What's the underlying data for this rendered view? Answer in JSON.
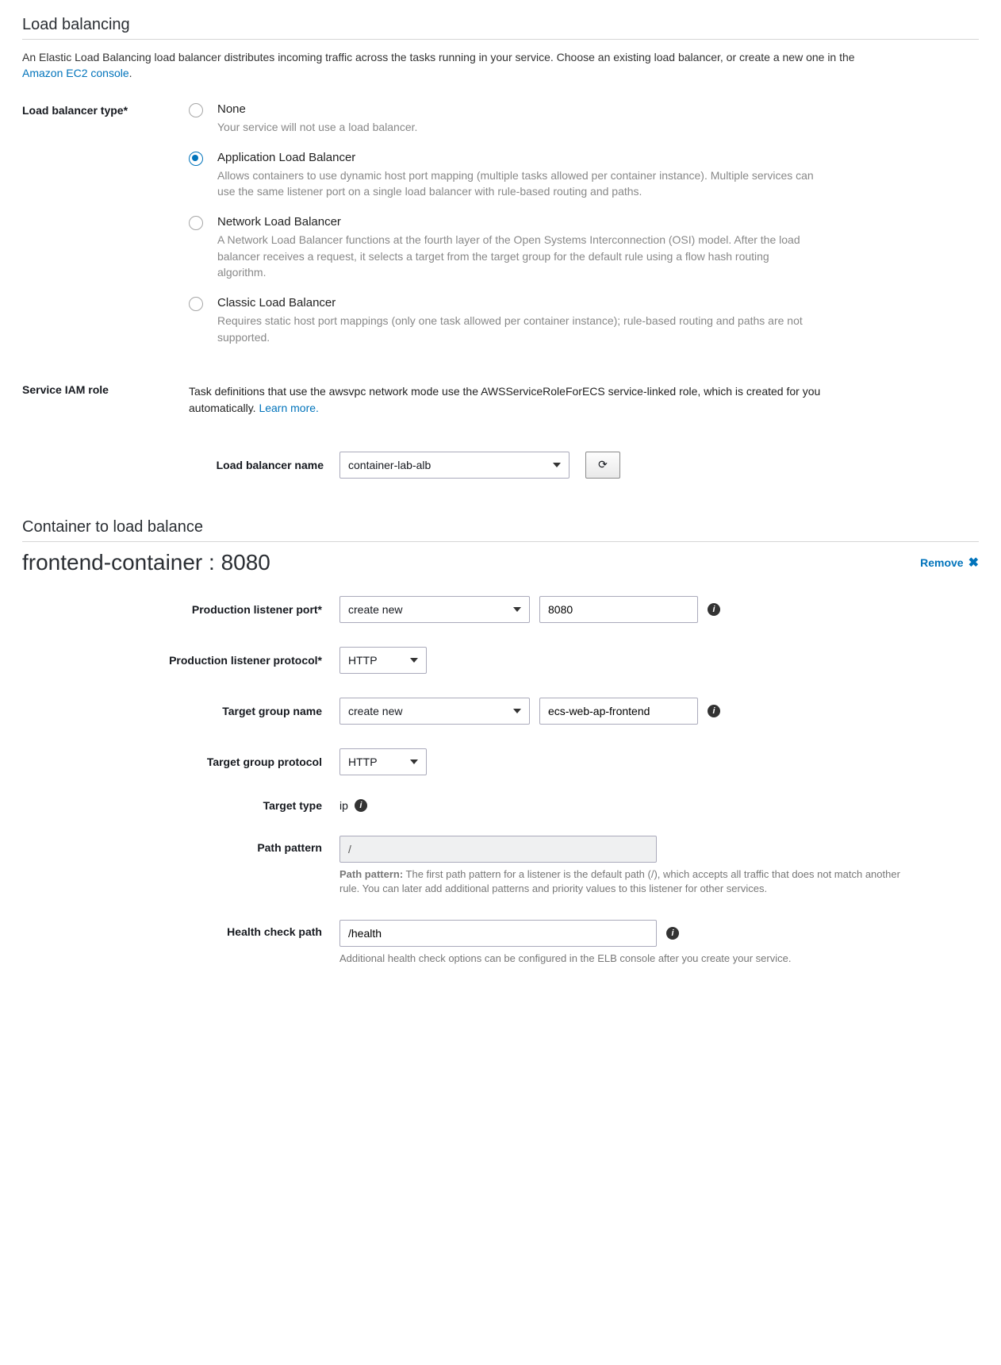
{
  "section1": {
    "title": "Load balancing",
    "desc_part1": "An Elastic Load Balancing load balancer distributes incoming traffic across the tasks running in your service. Choose an existing load balancer, or create a new one in the ",
    "desc_link": "Amazon EC2 console",
    "desc_part2": "."
  },
  "lb_type": {
    "label": "Load balancer type*",
    "options": [
      {
        "label": "None",
        "desc": "Your service will not use a load balancer."
      },
      {
        "label": "Application Load Balancer",
        "desc": "Allows containers to use dynamic host port mapping (multiple tasks allowed per container instance). Multiple services can use the same listener port on a single load balancer with rule-based routing and paths."
      },
      {
        "label": "Network Load Balancer",
        "desc": "A Network Load Balancer functions at the fourth layer of the Open Systems Interconnection (OSI) model. After the load balancer receives a request, it selects a target from the target group for the default rule using a flow hash routing algorithm."
      },
      {
        "label": "Classic Load Balancer",
        "desc": "Requires static host port mappings (only one task allowed per container instance); rule-based routing and paths are not supported."
      }
    ],
    "selected_index": 1
  },
  "iam": {
    "label": "Service IAM role",
    "text": "Task definitions that use the awsvpc network mode use the AWSServiceRoleForECS service-linked role, which is created for you automatically. ",
    "link": "Learn more."
  },
  "lb_name": {
    "label": "Load balancer name",
    "value": "container-lab-alb"
  },
  "section2_title": "Container to load balance",
  "container_title": "frontend-container : 8080",
  "remove_label": "Remove",
  "form": {
    "listener_port_label": "Production listener port*",
    "listener_port_select": "create new",
    "listener_port_value": "8080",
    "listener_proto_label": "Production listener protocol*",
    "listener_proto_value": "HTTP",
    "tg_name_label": "Target group name",
    "tg_name_select": "create new",
    "tg_name_value": "ecs-web-ap-frontend",
    "tg_proto_label": "Target group protocol",
    "tg_proto_value": "HTTP",
    "target_type_label": "Target type",
    "target_type_value": "ip",
    "path_pattern_label": "Path pattern",
    "path_pattern_value": "/",
    "path_help_bold": "Path pattern:",
    "path_help": " The first path pattern for a listener is the default path (/), which accepts all traffic that does not match another rule. You can later add additional patterns and priority values to this listener for other services.",
    "health_label": "Health check path",
    "health_value": "/health",
    "health_help": "Additional health check options can be configured in the ELB console after you create your service."
  }
}
